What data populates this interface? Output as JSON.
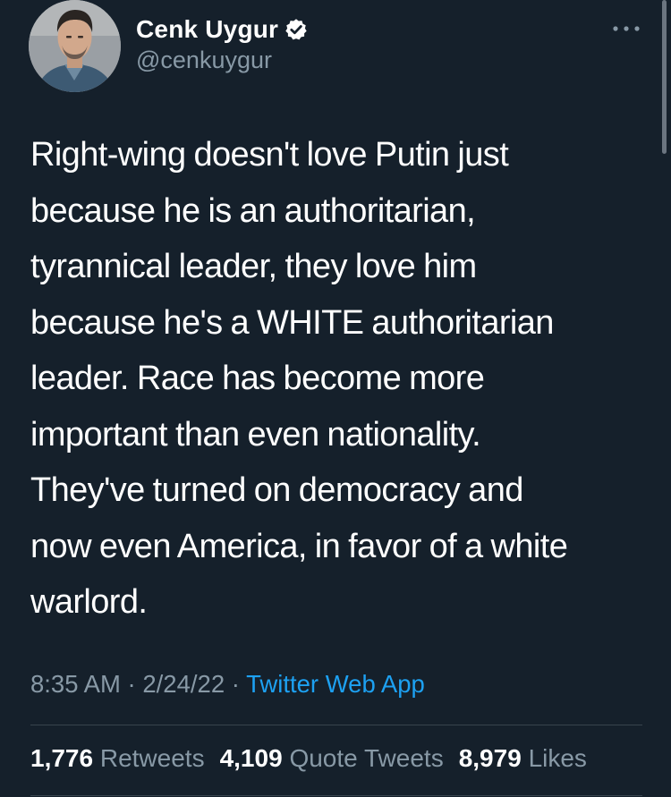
{
  "author": {
    "display_name": "Cenk Uygur",
    "handle": "@cenkuygur",
    "verified": true,
    "avatar_icon": "profile-photo"
  },
  "tweet": {
    "lines": [
      "Right-wing doesn't love Putin just",
      "because he is an authoritarian,",
      "tyrannical leader, they love him",
      "because he's a WHITE authoritarian",
      "leader. Race has become more",
      "important than even nationality.",
      "They've turned on democracy and",
      "now even America, in favor of a white",
      "warlord."
    ],
    "time": "8:35 AM",
    "separator": "·",
    "date": "2/24/22",
    "source": "Twitter Web App"
  },
  "stats": {
    "retweets_count": "1,776",
    "retweets_label": "Retweets",
    "quotes_count": "4,109",
    "quotes_label": "Quote Tweets",
    "likes_count": "8,979",
    "likes_label": "Likes"
  },
  "colors": {
    "background": "#15202b",
    "secondary_text": "#8899a6",
    "link": "#1da1f2",
    "divider": "#38444d"
  }
}
